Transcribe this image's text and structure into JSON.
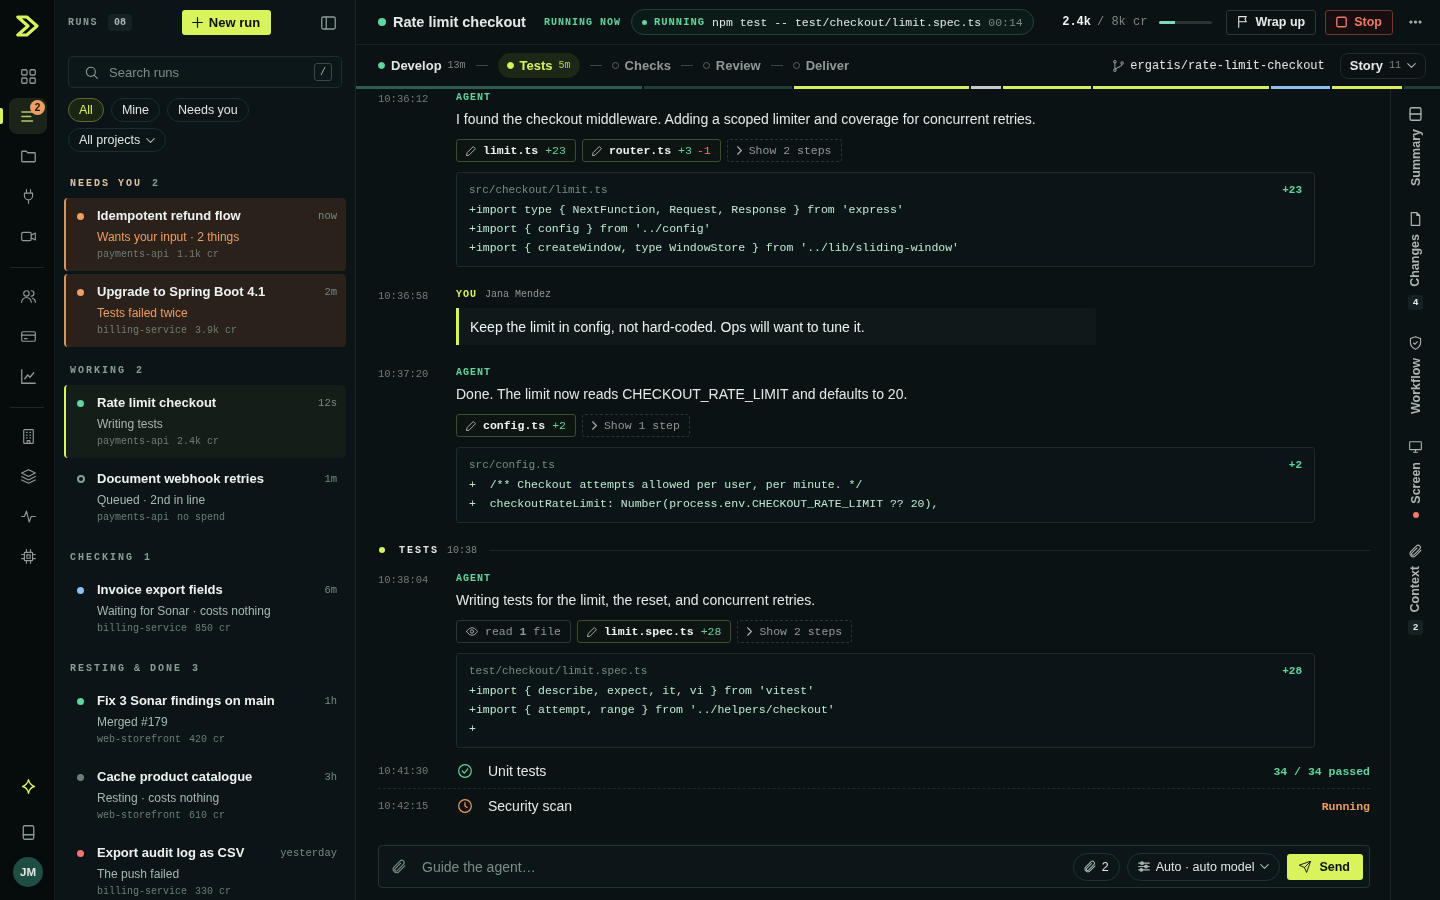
{
  "rail": {
    "groups": [
      {
        "items": [
          {
            "selected": false
          },
          {
            "selected": true,
            "badge": "2"
          },
          {
            "selected": false
          },
          {
            "selected": false
          },
          {
            "selected": false
          }
        ]
      },
      {
        "items": [
          {
            "selected": false
          },
          {
            "selected": false
          },
          {
            "selected": false
          }
        ]
      },
      {
        "items": [
          {
            "selected": false
          },
          {
            "selected": false
          },
          {
            "selected": false
          },
          {
            "selected": false
          }
        ]
      }
    ],
    "avatar": "JM"
  },
  "runs_panel": {
    "title": "RUNS",
    "count": "08",
    "new_button": "New run",
    "search": {
      "placeholder": "Search runs",
      "shortcut": "/"
    },
    "filters": [
      {
        "label": "All",
        "selected": true
      },
      {
        "label": "Mine",
        "selected": false
      },
      {
        "label": "Needs you",
        "selected": false
      }
    ],
    "project_filter": "All projects",
    "groups": [
      {
        "label": "NEEDS YOU",
        "count": "2",
        "kind": "attention",
        "runs": [
          {
            "title": "Idempotent refund flow",
            "time": "now",
            "status": "Wants your input · 2 things",
            "repo": "payments-api",
            "cost": "1.1k cr",
            "color": "#ee9d63",
            "queued": false,
            "selected": false
          },
          {
            "title": "Upgrade to Spring Boot 4.1",
            "time": "2m",
            "status": "Tests failed twice",
            "repo": "billing-service",
            "cost": "3.9k cr",
            "color": "#ee9d63",
            "queued": false,
            "selected": false
          }
        ]
      },
      {
        "label": "WORKING",
        "count": "2",
        "kind": "normal",
        "runs": [
          {
            "title": "Rate limit checkout",
            "time": "12s",
            "status": "Writing tests",
            "repo": "payments-api",
            "cost": "2.4k cr",
            "color": "#5fd6a0",
            "queued": false,
            "selected": true
          },
          {
            "title": "Document webhook retries",
            "time": "1m",
            "status": "Queued · 2nd in line",
            "repo": "payments-api",
            "cost": "no spend",
            "color": "#8d9a96",
            "queued": true,
            "selected": false
          }
        ]
      },
      {
        "label": "CHECKING",
        "count": "1",
        "kind": "normal",
        "runs": [
          {
            "title": "Invoice export fields",
            "time": "6m",
            "status": "Waiting for Sonar · costs nothing",
            "repo": "billing-service",
            "cost": "850 cr",
            "color": "#8cc0f5",
            "queued": false,
            "selected": false
          }
        ]
      },
      {
        "label": "RESTING & DONE",
        "count": "3",
        "kind": "normal",
        "runs": [
          {
            "title": "Fix 3 Sonar findings on main",
            "time": "1h",
            "status": "Merged #179",
            "repo": "web-storefront",
            "cost": "420 cr",
            "color": "#5fd6a0",
            "queued": false,
            "selected": false
          },
          {
            "title": "Cache product catalogue",
            "time": "3h",
            "status": "Resting · costs nothing",
            "repo": "web-storefront",
            "cost": "610 cr",
            "color": "#6f7d78",
            "queued": false,
            "selected": false
          },
          {
            "title": "Export audit log as CSV",
            "time": "yesterday",
            "status": "The push failed",
            "repo": "billing-service",
            "cost": "330 cr",
            "color": "#f2776a",
            "queued": false,
            "selected": false
          }
        ]
      }
    ]
  },
  "header": {
    "title": "Rate limit checkout",
    "state": "RUNNING NOW",
    "command": {
      "label": "RUNNING",
      "text": "npm test -- test/checkout/limit.spec.ts",
      "elapsed": "00:14"
    },
    "credits": {
      "used": "2.4k",
      "total": "/ 8k cr",
      "level": 0.3
    },
    "buttons": [
      {
        "label": "Wrap up",
        "kind": "flag"
      },
      {
        "label": "Stop",
        "kind": "stop"
      }
    ],
    "stages": [
      {
        "label": "Develop",
        "time": "13m",
        "done": true,
        "selected": false
      },
      {
        "label": "Tests",
        "time": "5m",
        "done": false,
        "selected": true
      },
      {
        "label": "Checks",
        "done": false,
        "selected": false
      },
      {
        "label": "Review",
        "done": false,
        "selected": false
      },
      {
        "label": "Deliver",
        "done": false,
        "selected": false
      }
    ],
    "branch": "ergatis/rate-limit-checkout",
    "story": {
      "label": "Story",
      "count": "11"
    }
  },
  "transcript": [
    {
      "kind": "agent",
      "time": "10:36:12",
      "author": "AGENT",
      "text": "I found the checkout middleware. Adding a scoped limiter and coverage for concurrent retries.",
      "chips": [
        {
          "kind": "edit",
          "file": "limit.ts",
          "added": "+23"
        },
        {
          "kind": "edit",
          "file": "router.ts",
          "added": "+3",
          "removed": "-1"
        },
        {
          "kind": "steps",
          "label": "Show 2 steps"
        }
      ],
      "code": {
        "path": "src/checkout/limit.ts",
        "count": "+23",
        "lines": [
          "+import type { NextFunction, Request, Response } from 'express'",
          "+import { config } from '../config'",
          "+import { createWindow, type WindowStore } from '../lib/sliding-window'"
        ]
      }
    },
    {
      "kind": "user",
      "time": "10:36:58",
      "author": "YOU",
      "name": "Jana Mendez",
      "text": "Keep the limit in config, not hard-coded. Ops will want to tune it."
    },
    {
      "kind": "agent",
      "time": "10:37:20",
      "author": "AGENT",
      "text": "Done. The limit now reads CHECKOUT_RATE_LIMIT and defaults to 20.",
      "chips": [
        {
          "kind": "edit",
          "file": "config.ts",
          "added": "+2"
        },
        {
          "kind": "steps",
          "label": "Show 1 step"
        }
      ],
      "code": {
        "path": "src/config.ts",
        "count": "+2",
        "lines": [
          "+  /** Checkout attempts allowed per user, per minute. */",
          "+  checkoutRateLimit: Number(process.env.CHECKOUT_RATE_LIMIT ?? 20),"
        ]
      }
    },
    {
      "kind": "section",
      "label": "TESTS",
      "time": "10:38"
    },
    {
      "kind": "agent",
      "time": "10:38:04",
      "author": "AGENT",
      "text": "Writing tests for the limit, the reset, and concurrent retries.",
      "chips": [
        {
          "kind": "read",
          "label": "read **1** file"
        },
        {
          "kind": "edit",
          "file": "limit.spec.ts",
          "added": "+28"
        },
        {
          "kind": "steps",
          "label": "Show 2 steps"
        }
      ],
      "code": {
        "path": "test/checkout/limit.spec.ts",
        "count": "+28",
        "lines": [
          "+import { describe, expect, it, vi } from 'vitest'",
          "+import { attempt, range } from '../helpers/checkout'",
          "+"
        ]
      }
    },
    {
      "kind": "check",
      "time": "10:41:30",
      "label": "Unit tests",
      "result": "34 / 34 passed",
      "passed": true
    },
    {
      "kind": "check",
      "time": "10:42:15",
      "label": "Security scan",
      "result": "Running",
      "passed": false
    }
  ],
  "composer": {
    "placeholder": "Guide the agent…",
    "attachments": "2",
    "model": "Auto · auto model",
    "send": "Send"
  },
  "side_tabs": [
    {
      "label": "Summary",
      "alert": false
    },
    {
      "label": "Changes",
      "badge": "4",
      "alert": false
    },
    {
      "label": "Workflow",
      "alert": false
    },
    {
      "label": "Screen",
      "alert": true
    },
    {
      "label": "Context",
      "badge": "2",
      "alert": false
    }
  ]
}
